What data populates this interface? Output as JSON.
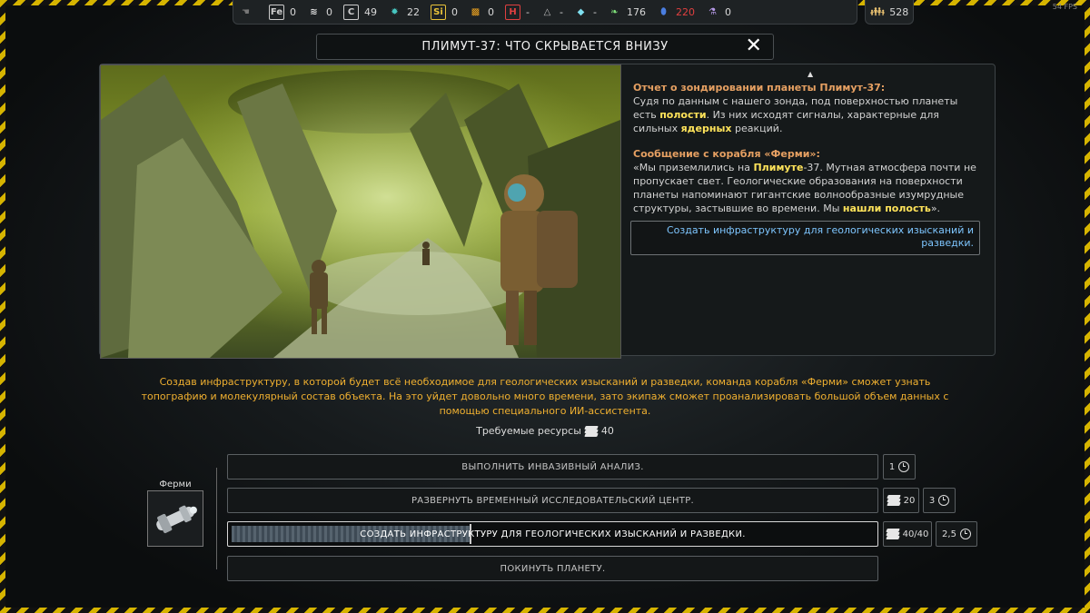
{
  "fps": "54 FPS",
  "resources": [
    {
      "icon": "hand-icon",
      "symbol": "☚",
      "value": "",
      "color": "#777777"
    },
    {
      "icon": "iron-icon",
      "symbol": "Fe",
      "value": "0",
      "color": "#cccccc"
    },
    {
      "icon": "layers-icon",
      "symbol": "≋",
      "value": "0",
      "color": "#e6e6e6"
    },
    {
      "icon": "carbon-icon",
      "symbol": "C",
      "value": "49",
      "color": "#cccccc"
    },
    {
      "icon": "gear-icon",
      "symbol": "✹",
      "value": "22",
      "color": "#47c6c0"
    },
    {
      "icon": "silicon-icon",
      "symbol": "Si",
      "value": "0",
      "color": "#e8c23a"
    },
    {
      "icon": "chip-icon",
      "symbol": "▩",
      "value": "0",
      "color": "#e8a020"
    },
    {
      "icon": "hydrogen-icon",
      "symbol": "H",
      "value": "-",
      "color": "#e04040"
    },
    {
      "icon": "radiation-icon",
      "symbol": "△",
      "value": "-",
      "color": "#bbbbbb"
    },
    {
      "icon": "crystal-icon",
      "symbol": "◆",
      "value": "-",
      "color": "#7fe0f0"
    },
    {
      "icon": "leaf-icon",
      "symbol": "❧",
      "value": "176",
      "color": "#7fe07a"
    },
    {
      "icon": "energy-icon",
      "symbol": "⬮",
      "value": "220",
      "color": "#4a7ee0",
      "value_color": "#e04040"
    },
    {
      "icon": "flask-icon",
      "symbol": "⚗",
      "value": "0",
      "color": "#b79ae8"
    }
  ],
  "population": {
    "icon": "people-icon",
    "value": "528"
  },
  "title": "ПЛИМУТ-37: ЧТО СКРЫВАЕТСЯ ВНИЗУ",
  "report": {
    "heading1": "Отчет о зондировании планеты Плимут-37:",
    "para1_a": "Судя по данным с нашего зонда, под поверхностью планеты есть ",
    "para1_b": "полости",
    "para1_c": ". Из них исходят сигналы, характерные для сильных ",
    "para1_d": "ядерных",
    "para1_e": " реакций.",
    "heading2": "Сообщение с корабля «Ферми»:",
    "para2_a": " «Мы приземлились на ",
    "para2_b": "Плимуте",
    "para2_c": "-37. Мутная атмосфера почти не пропускает свет. Геологические образования на поверхности планеты напоминают гигантские волнообразные изумрудные структуры, застывшие во времени. Мы ",
    "para2_d": "нашли полость",
    "para2_e": "».",
    "infra_button": "Создать инфраструктуру для геологических изысканий и разведки."
  },
  "description": "Создав инфраструктуру, в которой будет всё необходимое для геологических изысканий и разведки, команда корабля «Ферми» сможет узнать топографию и молекулярный состав объекта. На это уйдет довольно много времени, зато экипаж сможет проанализировать большой объем данных с помощью специального ИИ-ассистента.",
  "required_label": "Требуемые ресурсы",
  "required_value": "40",
  "ship_name": "Ферми",
  "options": [
    {
      "label": "ВЫПОЛНИТЬ ИНВАЗИВНЫЙ АНАЛИЗ.",
      "time": "1"
    },
    {
      "label": "РАЗВЕРНУТЬ ВРЕМЕННЫЙ ИССЛЕДОВАТЕЛЬСКИЙ ЦЕНТР.",
      "cost": "20",
      "time": "3"
    },
    {
      "label": "СОЗДАТЬ ИНФРАСТРУКТУРУ ДЛЯ ГЕОЛОГИЧЕСКИХ ИЗЫСКАНИЙ И РАЗВЕДКИ.",
      "cost": "40/40",
      "time": "2,5",
      "progress": 0.37
    },
    {
      "label": "ПОКИНУТЬ ПЛАНЕТУ."
    }
  ]
}
